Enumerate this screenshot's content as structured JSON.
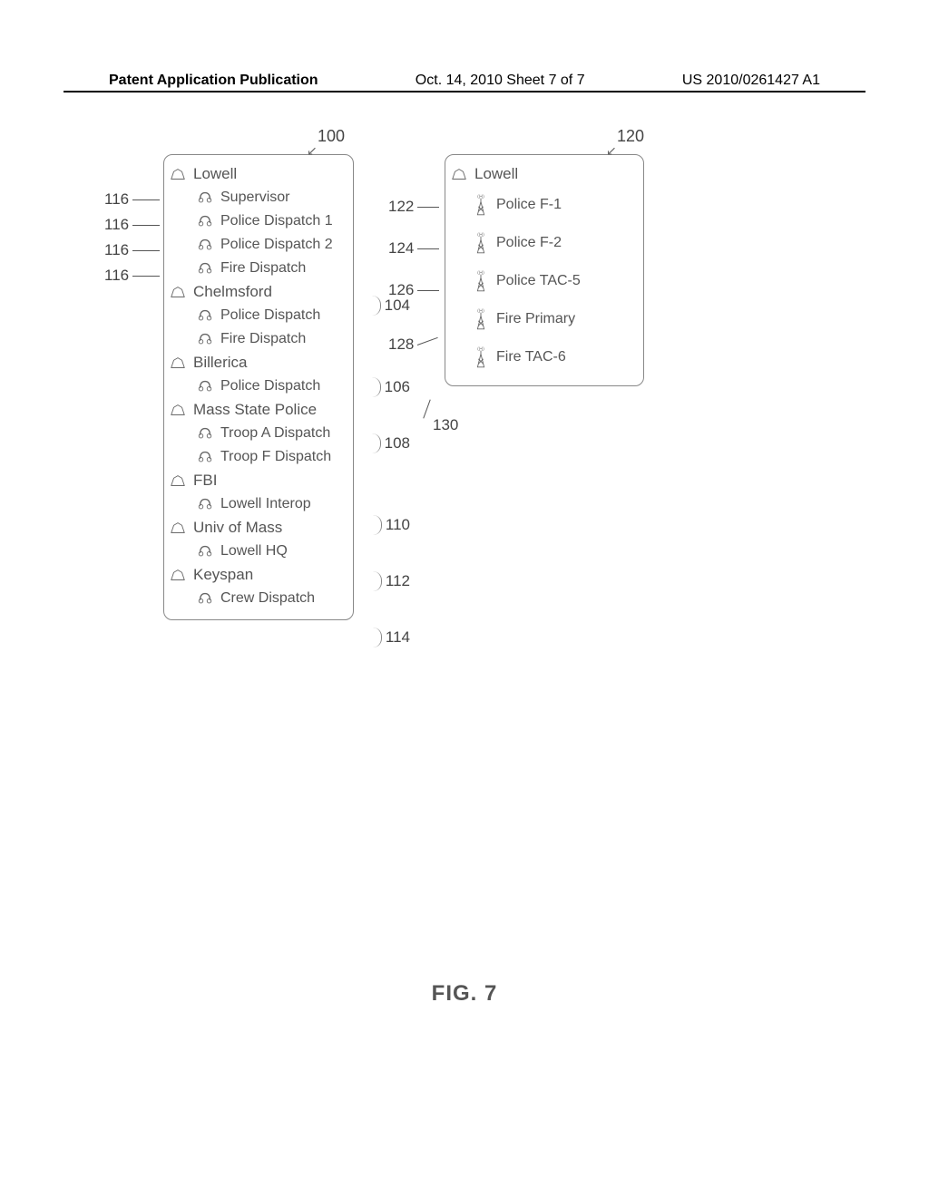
{
  "header": {
    "left": "Patent Application Publication",
    "center": "Oct. 14, 2010  Sheet 7 of 7",
    "right": "US 2010/0261427 A1"
  },
  "figure_label": "FIG. 7",
  "panel_left": {
    "ref": "100",
    "groups": [
      {
        "name": "Lowell",
        "ref": null,
        "items": [
          {
            "label": "Supervisor",
            "ref": "116"
          },
          {
            "label": "Police Dispatch 1",
            "ref": "116"
          },
          {
            "label": "Police Dispatch 2",
            "ref": "116"
          },
          {
            "label": "Fire Dispatch",
            "ref": "116"
          }
        ]
      },
      {
        "name": "Chelmsford",
        "ref": "104",
        "items": [
          {
            "label": "Police Dispatch"
          },
          {
            "label": "Fire Dispatch"
          }
        ]
      },
      {
        "name": "Billerica",
        "ref": "106",
        "items": [
          {
            "label": "Police Dispatch"
          }
        ]
      },
      {
        "name": "Mass State Police",
        "ref": "108",
        "items": [
          {
            "label": "Troop A Dispatch"
          },
          {
            "label": "Troop F Dispatch"
          }
        ]
      },
      {
        "name": "FBI",
        "ref": "110",
        "items": [
          {
            "label": "Lowell Interop"
          }
        ]
      },
      {
        "name": "Univ of Mass",
        "ref": "112",
        "items": [
          {
            "label": "Lowell HQ"
          }
        ]
      },
      {
        "name": "Keyspan",
        "ref": "114",
        "items": [
          {
            "label": "Crew Dispatch"
          }
        ]
      }
    ]
  },
  "panel_right": {
    "ref": "120",
    "extra_ref": "130",
    "header": "Lowell",
    "items": [
      {
        "label": "Police F-1",
        "ref": "122"
      },
      {
        "label": "Police F-2",
        "ref": "124"
      },
      {
        "label": "Police TAC-5",
        "ref": "126"
      },
      {
        "label": "Fire Primary",
        "ref": "128"
      },
      {
        "label": "Fire TAC-6"
      }
    ]
  }
}
